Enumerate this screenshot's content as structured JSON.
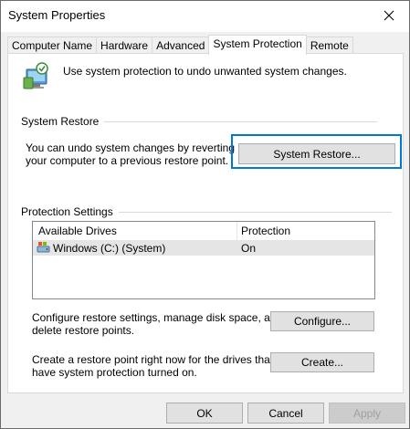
{
  "window": {
    "title": "System Properties"
  },
  "tabs": [
    {
      "label": "Computer Name"
    },
    {
      "label": "Hardware"
    },
    {
      "label": "Advanced"
    },
    {
      "label": "System Protection"
    },
    {
      "label": "Remote"
    }
  ],
  "intro": {
    "text": "Use system protection to undo unwanted system changes."
  },
  "system_restore": {
    "heading": "System Restore",
    "description_line1": "You can undo system changes by reverting",
    "description_line2": "your computer to a previous restore point.",
    "button_label": "System Restore..."
  },
  "protection": {
    "heading": "Protection Settings",
    "columns": [
      "Available Drives",
      "Protection"
    ],
    "rows": [
      {
        "drive": "Windows (C:) (System)",
        "protection": "On"
      }
    ],
    "configure_text_line1": "Configure restore settings, manage disk space, and",
    "configure_text_line2": "delete restore points.",
    "configure_label": "Configure...",
    "create_text_line1": "Create a restore point right now for the drives that",
    "create_text_line2": "have system protection turned on.",
    "create_label": "Create..."
  },
  "footer": {
    "ok_label": "OK",
    "cancel_label": "Cancel",
    "apply_label": "Apply"
  },
  "colors": {
    "focus": "#0078d7",
    "button_face": "#e1e1e1",
    "dialog_bg": "#f0f0f0"
  }
}
